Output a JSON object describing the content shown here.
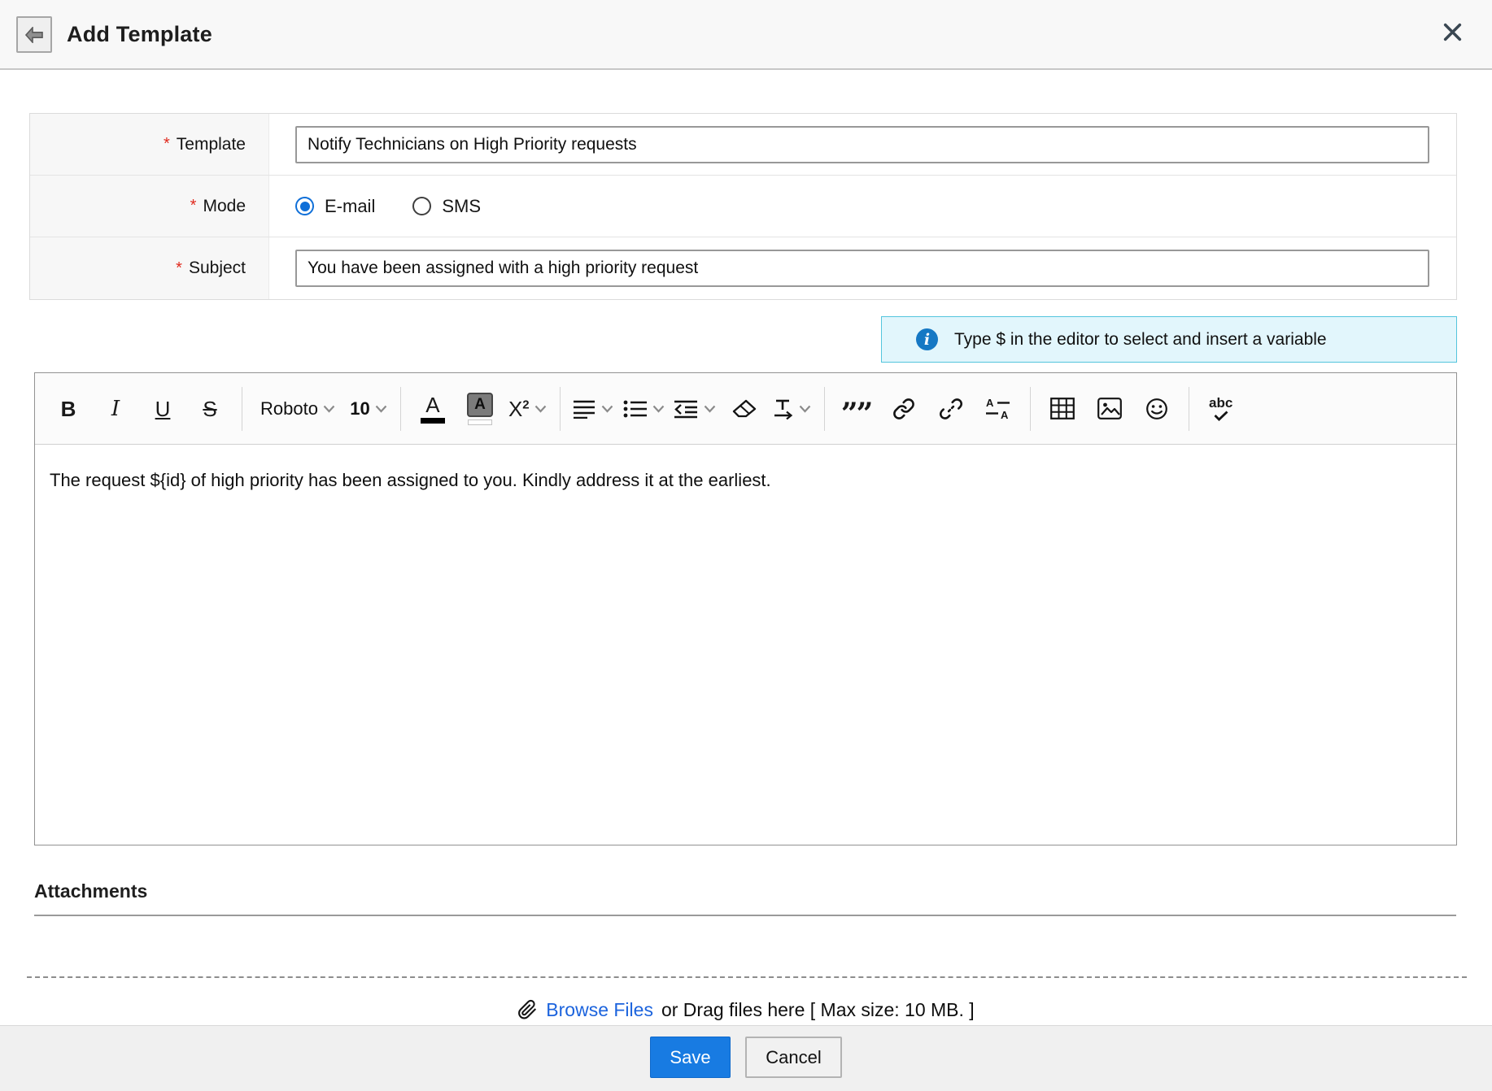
{
  "header": {
    "title": "Add Template"
  },
  "form": {
    "template": {
      "required": "*",
      "label": "Template",
      "value": "Notify Technicians on High Priority requests"
    },
    "mode": {
      "required": "*",
      "label": "Mode",
      "options": [
        {
          "label": "E-mail",
          "selected": true
        },
        {
          "label": "SMS",
          "selected": false
        }
      ]
    },
    "subject": {
      "required": "*",
      "label": "Subject",
      "value": "You have been assigned with a high priority request"
    }
  },
  "info_banner": {
    "icon_glyph": "i",
    "text": "Type $ in the editor to select and insert a variable"
  },
  "editor": {
    "toolbar": {
      "bold": "B",
      "italic": "I",
      "underline": "U",
      "strikethrough": "S",
      "font_family": "Roboto",
      "font_size": "10",
      "font_color_letter": "A",
      "highlight_letter": "A",
      "superscript_base": "X",
      "superscript_exp": "2",
      "blockquote_glyph": "””",
      "spellcheck_text": "abc"
    },
    "content": "The request ${id} of high priority has been assigned to you. Kindly address it at the earliest."
  },
  "attachments": {
    "title": "Attachments"
  },
  "upload": {
    "browse_label": "Browse Files",
    "drag_text": "or Drag files here [ Max size: 10 MB. ]"
  },
  "footer": {
    "save": "Save",
    "cancel": "Cancel"
  },
  "colors": {
    "accent_blue": "#187be2",
    "radio_blue": "#0f6fd8",
    "banner_bg": "#e2f6fc",
    "banner_border": "#54c5dd",
    "info_icon_blue": "#1578c4",
    "link_blue": "#1b63dd"
  }
}
